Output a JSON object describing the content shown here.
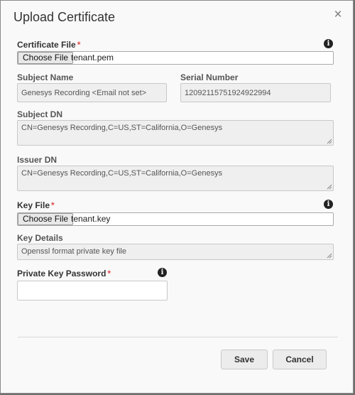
{
  "dialog": {
    "title": "Upload Certificate",
    "close_glyph": "×"
  },
  "certificate_file": {
    "label": "Certificate File",
    "required_mark": "*",
    "button_label": "Choose File",
    "file_name": "tenant.pem",
    "info_icon": "info-circle-icon"
  },
  "subject_name": {
    "label": "Subject Name",
    "value": "Genesys Recording <Email not set>"
  },
  "serial_number": {
    "label": "Serial Number",
    "value": "120921157519249229​94"
  },
  "subject_dn": {
    "label": "Subject DN",
    "value": "CN=Genesys Recording,C=US,ST=California,O=Genesys"
  },
  "issuer_dn": {
    "label": "Issuer DN",
    "value": "CN=Genesys Recording,C=US,ST=California,O=Genesys"
  },
  "key_file": {
    "label": "Key File",
    "required_mark": "*",
    "button_label": "Choose File",
    "file_name": "tenant.key",
    "info_icon": "info-circle-icon"
  },
  "key_details": {
    "label": "Key Details",
    "value": "Openssl format private key file"
  },
  "private_key_password": {
    "label": "Private Key Password",
    "required_mark": "*",
    "value": "",
    "info_icon": "info-circle-icon"
  },
  "footer": {
    "save_label": "Save",
    "cancel_label": "Cancel"
  },
  "colors": {
    "required": "#e05050",
    "overlay": "#6f6f6f",
    "panel": "#f9f9f9",
    "readonly_field": "#efefef"
  }
}
